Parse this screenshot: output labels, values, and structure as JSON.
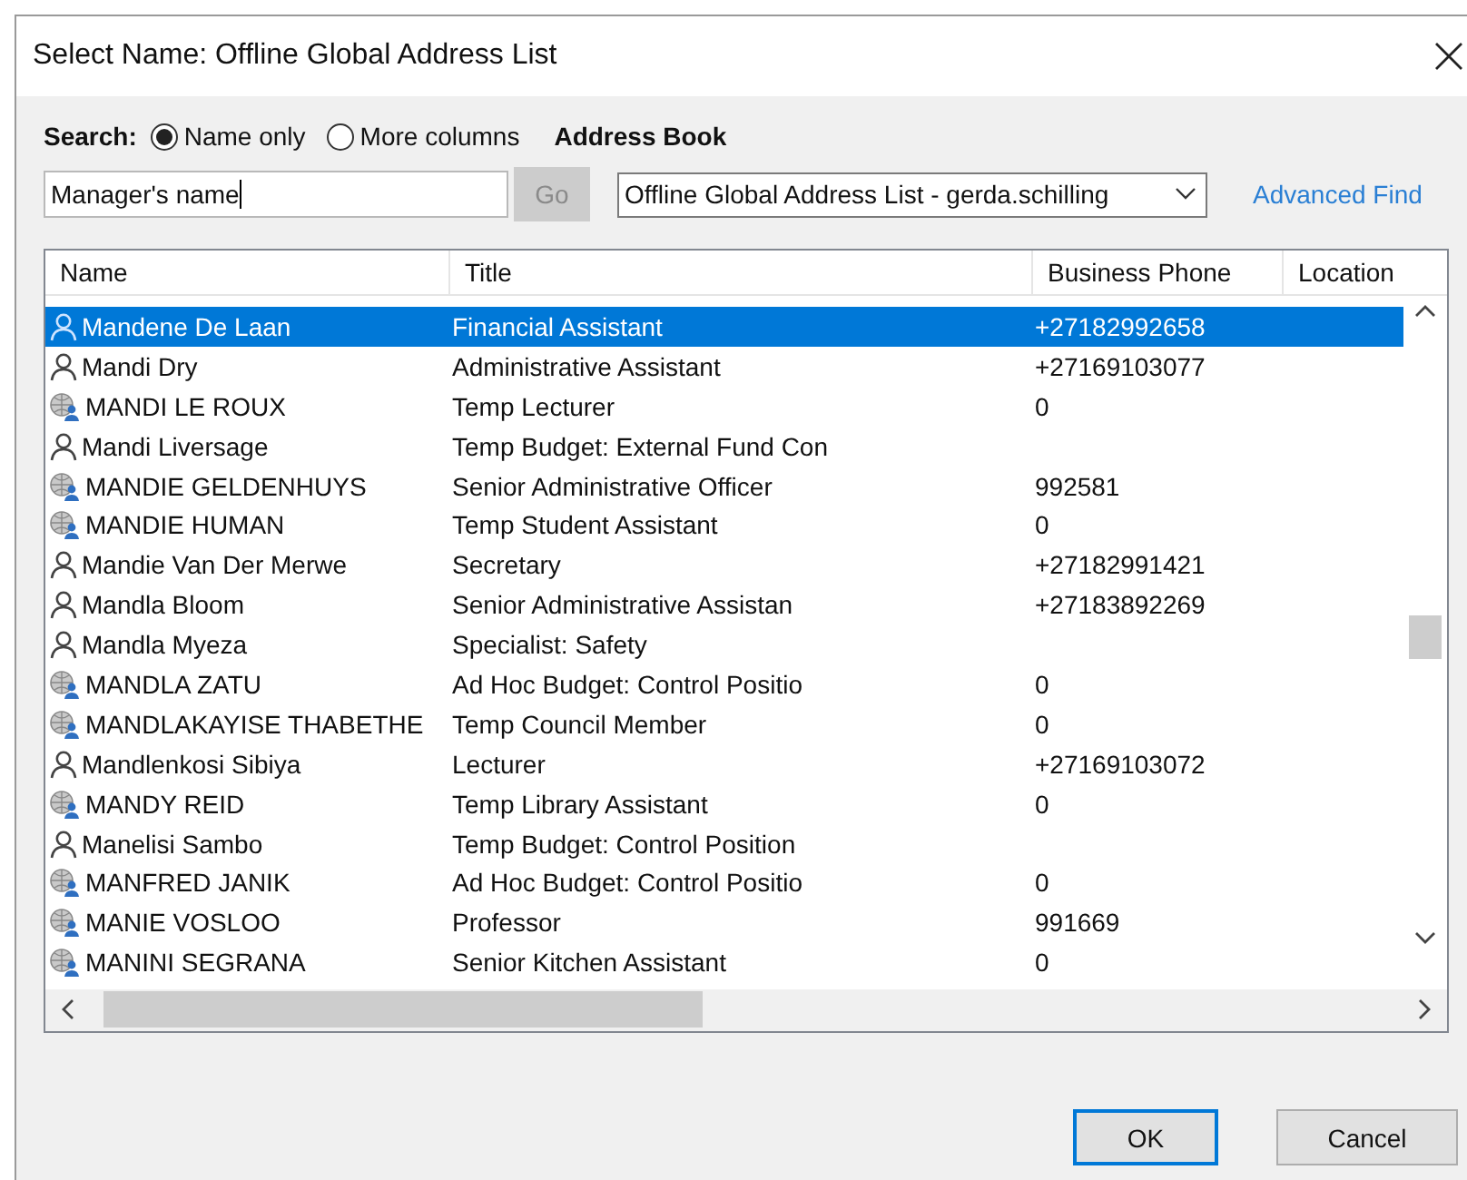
{
  "window": {
    "title": "Select Name: Offline Global Address List"
  },
  "search": {
    "label": "Search:",
    "options": [
      {
        "label": "Name only",
        "selected": true
      },
      {
        "label": "More columns",
        "selected": false
      }
    ],
    "value": "Manager's name",
    "go_button": {
      "label": "Go",
      "disabled": true
    }
  },
  "address_book": {
    "label": "Address Book",
    "value": "Offline Global Address List - gerda.schilling"
  },
  "advanced_find": "Advanced Find",
  "table": {
    "columns": [
      "Name",
      "Title",
      "Business Phone",
      "Location"
    ],
    "rows": [
      {
        "kind": "user",
        "name": "Mandene De Laan",
        "title": "Financial Assistant",
        "phone": "+27182992658",
        "selected": true
      },
      {
        "kind": "user",
        "name": "Mandi Dry",
        "title": "Administrative Assistant",
        "phone": "+27169103077",
        "selected": false
      },
      {
        "kind": "group",
        "name": "MANDI LE ROUX",
        "title": "Temp Lecturer",
        "phone": "0",
        "selected": false
      },
      {
        "kind": "user",
        "name": "Mandi Liversage",
        "title": "Temp Budget: External Fund Con",
        "selected": false
      },
      {
        "kind": "group",
        "name": "MANDIE GELDENHUYS",
        "title": "Senior Administrative Officer",
        "phone": "992581",
        "selected": false
      },
      {
        "kind": "group",
        "name": "MANDIE HUMAN",
        "title": "Temp Student Assistant",
        "phone": "0",
        "selected": false
      },
      {
        "kind": "user",
        "name": "Mandie Van Der Merwe",
        "title": "Secretary",
        "phone": "+27182991421",
        "selected": false
      },
      {
        "kind": "user",
        "name": "Mandla Bloom",
        "title": "Senior Administrative Assistan",
        "phone": "+27183892269",
        "selected": false
      },
      {
        "kind": "user",
        "name": "Mandla Myeza",
        "title": "Specialist: Safety",
        "selected": false
      },
      {
        "kind": "group",
        "name": "MANDLA ZATU",
        "title": "Ad Hoc Budget: Control Positio",
        "phone": "0",
        "selected": false
      },
      {
        "kind": "group",
        "name": "MANDLAKAYISE THABETHE",
        "title": "Temp Council Member",
        "phone": "0",
        "selected": false
      },
      {
        "kind": "user",
        "name": "Mandlenkosi Sibiya",
        "title": "Lecturer",
        "phone": "+27169103072",
        "selected": false
      },
      {
        "kind": "group",
        "name": "MANDY REID",
        "title": "Temp Library Assistant",
        "phone": "0",
        "selected": false
      },
      {
        "kind": "user",
        "name": "Manelisi Sambo",
        "title": "Temp Budget: Control Position",
        "selected": false
      },
      {
        "kind": "group",
        "name": "MANFRED JANIK",
        "title": "Ad Hoc Budget: Control Positio",
        "phone": "0",
        "selected": false
      },
      {
        "kind": "group",
        "name": "MANIE VOSLOO",
        "title": "Professor",
        "phone": "991669",
        "selected": false
      },
      {
        "kind": "group",
        "name": "MANINI SEGRANA",
        "title": "Senior Kitchen Assistant",
        "phone": "0",
        "selected": false
      }
    ]
  },
  "buttons": [
    {
      "label": "OK",
      "default": true
    },
    {
      "label": "Cancel",
      "default": false
    }
  ]
}
